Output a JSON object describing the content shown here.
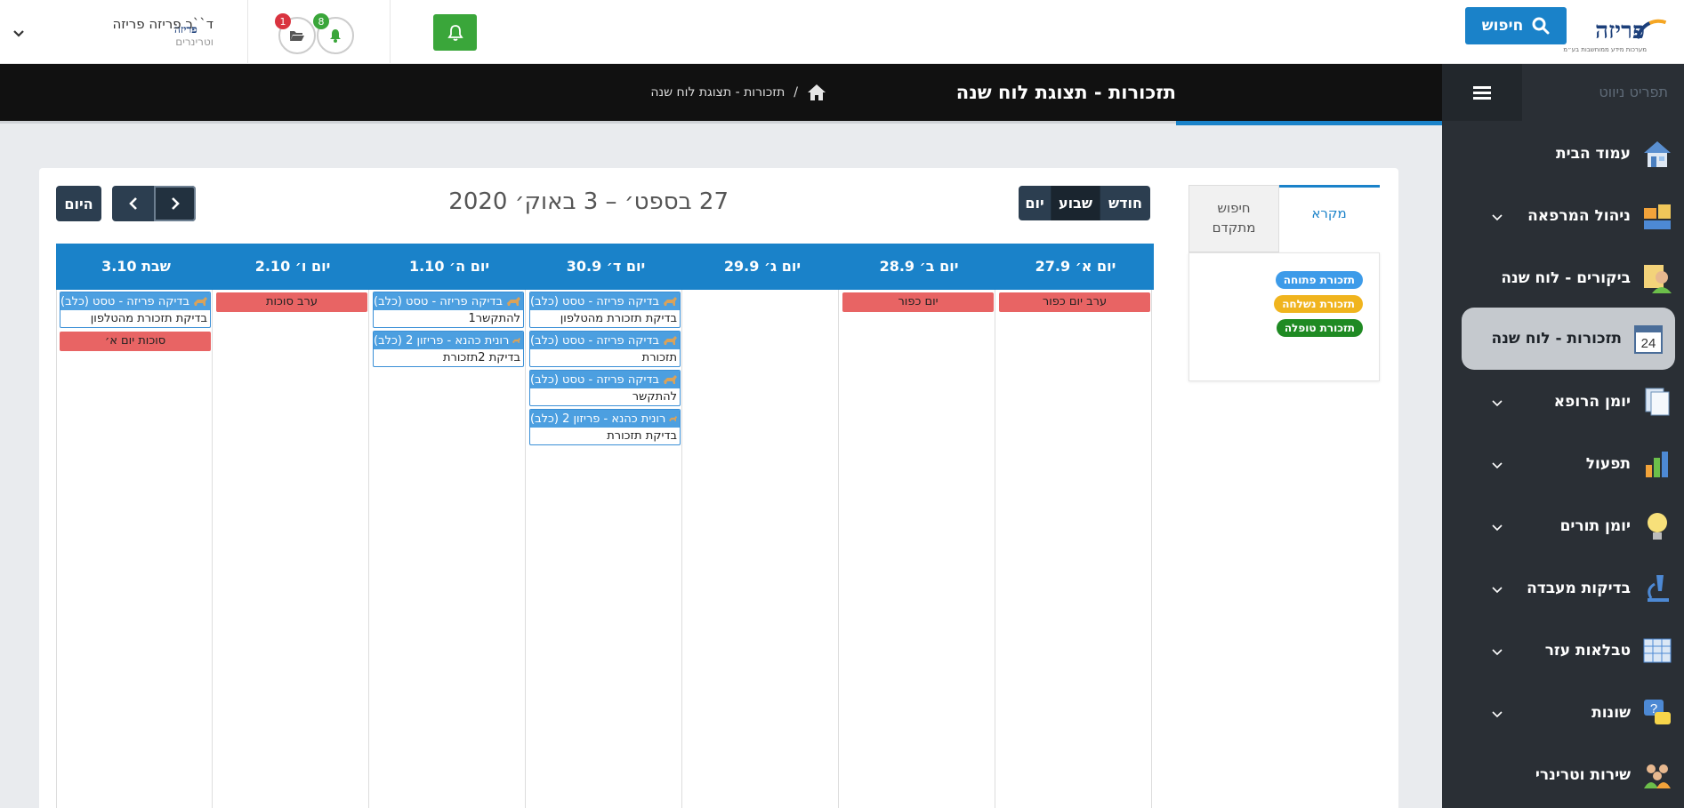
{
  "header": {
    "logo_text": "פריזה",
    "logo_subtext": "מערכות מידע ממוחשבות בע״מ",
    "search_label": "חיפוש",
    "user_name": "ד``ר פריזה פריזה",
    "user_role": "וטרינרים",
    "user_logo_text": "פריזה",
    "badge_folders": "1",
    "badge_bell": "8"
  },
  "sidebar": {
    "title": "תפריט ניווט",
    "items": [
      {
        "label": "עמוד הבית"
      },
      {
        "label": "ניהול המרפאה"
      },
      {
        "label": "ביקורים - לוח שנה"
      },
      {
        "label": "תזכורות - לוח שנה"
      },
      {
        "label": "יומן הרופא"
      },
      {
        "label": "תפעול"
      },
      {
        "label": "יומן תורים"
      },
      {
        "label": "בדיקות מעבדה"
      },
      {
        "label": "טבלאות עזר"
      },
      {
        "label": "שונות"
      },
      {
        "label": "שירות וטרינרי"
      }
    ]
  },
  "page": {
    "title": "תזכורות - תצוגת לוח שנה",
    "breadcrumb_current": "תזכורות - תצוגת לוח שנה",
    "breadcrumb_sep": "/"
  },
  "legend": {
    "tab_legend": "מקרא",
    "tab_adv_search_1": "חיפוש",
    "tab_adv_search_2": "מתקדם",
    "open": "תזכורת פתוחה",
    "sent": "תזכורת נשלחה",
    "handled": "תזכורת טופלה"
  },
  "toolbar": {
    "month": "חודש",
    "week": "שבוע",
    "day": "יום",
    "today": "היום",
    "date_range": "27 בספט׳ – 3 באוק׳ 2020"
  },
  "calendar": {
    "days": [
      {
        "head": "יום א׳ 27.9"
      },
      {
        "head": "יום ב׳ 28.9"
      },
      {
        "head": "יום ג׳ 29.9"
      },
      {
        "head": "יום ד׳ 30.9"
      },
      {
        "head": "יום ה׳ 1.10"
      },
      {
        "head": "יום ו׳ 2.10"
      },
      {
        "head": "שבת 3.10"
      }
    ],
    "holidays": {
      "d0": "ערב יום כפור",
      "d1": "יום כפור",
      "d5": "ערב סוכות",
      "d6": "סוכות יום א׳"
    },
    "events": {
      "e_d3_1_title": "בדיקה פריזה - טסט (כלב)",
      "e_d3_1_text": "בדיקת תזכורת מהטלפון",
      "e_d3_2_title": "בדיקה פריזה - טסט (כלב)",
      "e_d3_2_text": "תזכורת",
      "e_d3_3_title": "בדיקה פריזה - טסט (כלב)",
      "e_d3_3_text": "להתקשר",
      "e_d3_4_title": "רונית כהנא - פריזון 2 (כלב)",
      "e_d3_4_text": "בדיקת תזכורת",
      "e_d4_1_title": "בדיקה פריזה - טסט (כלב)",
      "e_d4_1_text": "להתקשר1",
      "e_d4_2_title": "רונית כהנא - פריזון 2 (כלב)",
      "e_d4_2_text": "בדיקת 2תזכורת",
      "e_d6_1_title": "בדיקה פריזה - טסט (כלב)",
      "e_d6_1_text": "בדיקת תזכורת מהטלפון"
    }
  },
  "colors": {
    "accent": "#1a82c9",
    "sidebar_bg": "#2a2f35",
    "open": "#3d9be9",
    "sent": "#f0b41e",
    "handled": "#1f8a23",
    "holiday": "#e86464"
  }
}
